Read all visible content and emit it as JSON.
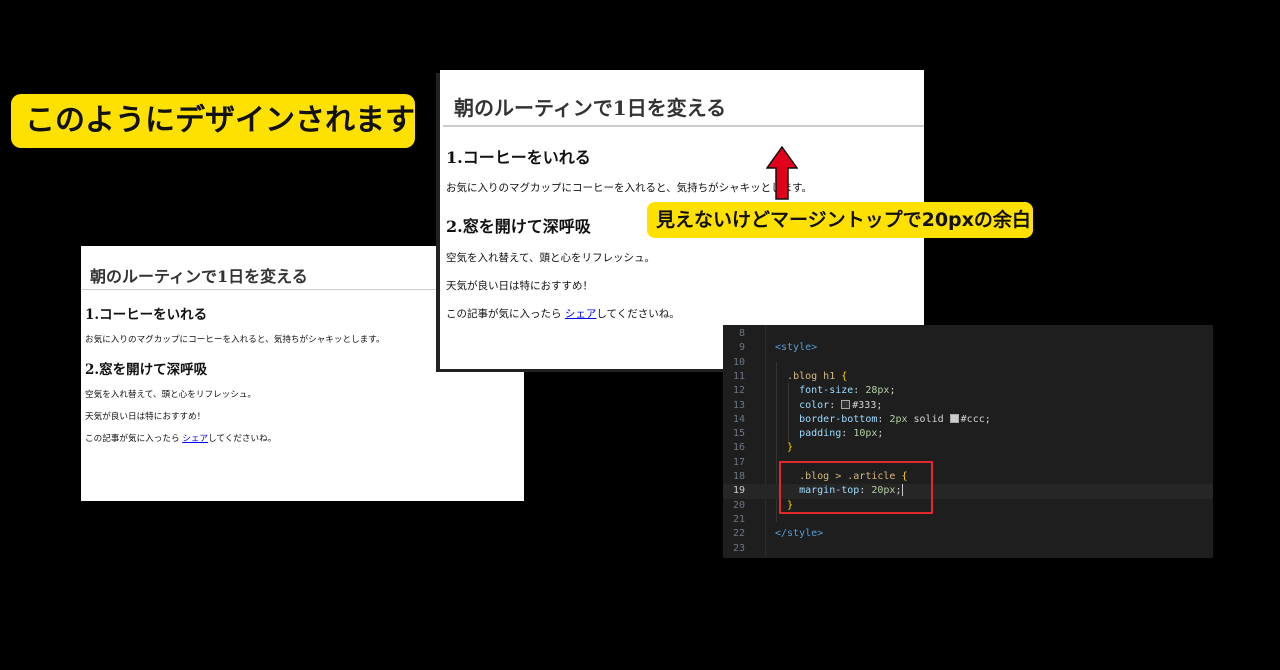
{
  "headline": "このようにデザインされます",
  "annotation": "見えないけどマージントップで20pxの余白",
  "page_small": {
    "title": "朝のルーティンで1日を変える",
    "article1_heading": "1.コーヒーをいれる",
    "article1_text": "お気に入りのマグカップにコーヒーを入れると、気持ちがシャキッとします。",
    "article2_heading": "2.窓を開けて深呼吸",
    "article2_text1": "空気を入れ替えて、頭と心をリフレッシュ。",
    "article2_text2": "天気が良い日は特におすすめ！",
    "share_prefix": "この記事が気に入ったら ",
    "share_link": "シェア",
    "share_suffix": "してくださいね。"
  },
  "page_large": {
    "title": "朝のルーティンで1日を変える",
    "article1_heading": "1.コーヒーをいれる",
    "article1_text": "お気に入りのマグカップにコーヒーを入れると、気持ちがシャキッとします。",
    "article2_heading": "2.窓を開けて深呼吸",
    "article2_text1": "空気を入れ替えて、頭と心をリフレッシュ。",
    "article2_text2": "天気が良い日は特におすすめ！",
    "share_prefix": "この記事が気に入ったら ",
    "share_link": "シェア",
    "share_suffix": "してくださいね。"
  },
  "editor": {
    "current_line": 19,
    "lines": [
      {
        "n": "8",
        "t": ""
      },
      {
        "n": "9",
        "t": "<style>"
      },
      {
        "n": "10",
        "t": ""
      },
      {
        "n": "11",
        "t": "  .blog h1 {"
      },
      {
        "n": "12",
        "t": "    font-size: 28px;"
      },
      {
        "n": "13",
        "t": "    color: #333;"
      },
      {
        "n": "14",
        "t": "    border-bottom: 2px solid #ccc;"
      },
      {
        "n": "15",
        "t": "    padding: 10px;"
      },
      {
        "n": "16",
        "t": "  }"
      },
      {
        "n": "17",
        "t": ""
      },
      {
        "n": "18",
        "t": "    .blog > .article {"
      },
      {
        "n": "19",
        "t": "    margin-top: 20px;"
      },
      {
        "n": "20",
        "t": "  }"
      },
      {
        "n": "21",
        "t": ""
      },
      {
        "n": "22",
        "t": "</style>"
      },
      {
        "n": "23",
        "t": ""
      }
    ]
  },
  "colors": {
    "label_bg": "#ffe100",
    "arrow": "#e3001b",
    "highlight_box": "#e0282e",
    "editor_bg": "#1e1e1e"
  }
}
